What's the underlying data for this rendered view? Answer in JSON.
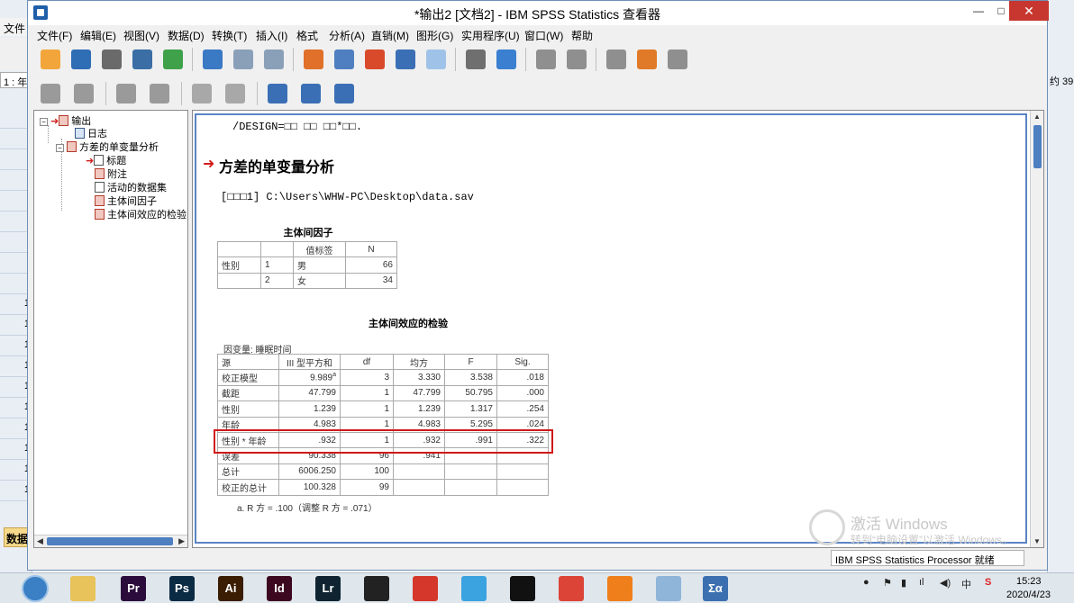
{
  "window": {
    "title": "*输出2 [文档2] - IBM SPSS Statistics 查看器",
    "minimize": "—",
    "maximize": "□",
    "close": "✕"
  },
  "background_editor": {
    "menu": "文件",
    "cell_ref": "1 : 年",
    "right_label": "约 39",
    "rows": [
      "",
      "",
      "",
      "",
      "",
      "",
      "",
      "",
      "",
      "1",
      "1",
      "1",
      "1",
      "1",
      "1",
      "1",
      "1",
      "1",
      "1"
    ],
    "tab": "数据"
  },
  "menubar": {
    "items": [
      "文件(F)",
      "编辑(E)",
      "视图(V)",
      "数据(D)",
      "转换(T)",
      "插入(I)",
      "格式",
      "分析(A)",
      "直销(M)",
      "图形(G)",
      "实用程序(U)",
      "窗口(W)",
      "帮助"
    ]
  },
  "toolbar1": {
    "buttons": [
      "open-icon",
      "save-icon",
      "print-icon",
      "print-preview-icon",
      "export-icon",
      "recall-dialog-icon",
      "undo-icon",
      "redo-icon",
      "goto-data-icon",
      "goto-case-icon",
      "goto-variable-icon",
      "variables-icon",
      "insert-case-icon",
      "insert-variable-icon",
      "split-file-icon",
      "select-cases-icon",
      "weight-cases-icon",
      "value-labels-icon",
      "use-sets-icon",
      "show-all-icon"
    ],
    "colors": [
      "#f2a53a",
      "#2f6db5",
      "#6a6a6a",
      "#3a6ea5",
      "#3fa14a",
      "#3a79c4",
      "#8aa0b8",
      "#8aa0b8",
      "#e0702a",
      "#4f7fc0",
      "#d84a2a",
      "#3a6fb5",
      "#9fc3e8",
      "#6f6f6f",
      "#3a7fd0",
      "#8f8f8f",
      "#8f8f8f",
      "#8f8f8f",
      "#e07a28",
      "#8f8f8f"
    ]
  },
  "toolbar2": {
    "buttons": [
      "promote-icon",
      "demote-icon",
      "expand-icon",
      "collapse-icon",
      "show-icon",
      "hide-icon",
      "insert-heading-icon",
      "insert-title-icon",
      "insert-text-icon"
    ],
    "colors": [
      "#9a9a9a",
      "#9a9a9a",
      "#9a9a9a",
      "#9a9a9a",
      "#a8a8a8",
      "#a8a8a8",
      "#3a6fb5",
      "#3a6fb5",
      "#3a6fb5"
    ]
  },
  "outline": {
    "root": "输出",
    "log": "日志",
    "procedure": "方差的单变量分析",
    "children": [
      "标题",
      "附注",
      "活动的数据集",
      "主体间因子",
      "主体间效应的检验"
    ]
  },
  "content": {
    "design_line": "/DESIGN=□□ □□ □□*□□.",
    "section_title": "方差的单变量分析",
    "dataset_line": "[□□□1] C:\\Users\\WHW-PC\\Desktop\\data.sav",
    "factors_table": {
      "title": "主体间因子",
      "headers": [
        "",
        "",
        "值标签",
        "N"
      ],
      "rows": [
        [
          "性别",
          "1",
          "男",
          "66"
        ],
        [
          "",
          "2",
          "女",
          "34"
        ]
      ]
    },
    "effects_table": {
      "title": "主体间效应的检验",
      "dependent_variable": "因变量: 睡眠时间",
      "headers": [
        "源",
        "III 型平方和",
        "df",
        "均方",
        "F",
        "Sig."
      ],
      "rows": [
        [
          "校正模型",
          "9.989",
          "3",
          "3.330",
          "3.538",
          ".018"
        ],
        [
          "截距",
          "47.799",
          "1",
          "47.799",
          "50.795",
          ".000"
        ],
        [
          "性别",
          "1.239",
          "1",
          "1.239",
          "1.317",
          ".254"
        ],
        [
          "年龄",
          "4.983",
          "1",
          "4.983",
          "5.295",
          ".024"
        ],
        [
          "性别 * 年龄",
          ".932",
          "1",
          ".932",
          ".991",
          ".322"
        ],
        [
          "误差",
          "90.338",
          "96",
          ".941",
          "",
          ""
        ],
        [
          "总计",
          "6006.250",
          "100",
          "",
          "",
          ""
        ],
        [
          "校正的总计",
          "100.328",
          "99",
          "",
          "",
          ""
        ]
      ],
      "superscript": "a",
      "footnote": "a. R 方 = .100（调整 R 方 = .071）"
    },
    "watermark_line1": "激活 Windows",
    "watermark_line2": "转到“电脑设置”以激活 Windows。"
  },
  "status": {
    "text": "IBM SPSS Statistics Processor 就绪"
  },
  "taskbar": {
    "apps": [
      {
        "label": "",
        "name": "file-explorer-icon",
        "color": "#e8c25a"
      },
      {
        "label": "Pr",
        "name": "premiere-icon",
        "color": "#2a0b3c"
      },
      {
        "label": "Ps",
        "name": "photoshop-icon",
        "color": "#0b2a44"
      },
      {
        "label": "Ai",
        "name": "illustrator-icon",
        "color": "#3a1d02"
      },
      {
        "label": "Id",
        "name": "indesign-icon",
        "color": "#3c0820"
      },
      {
        "label": "Lr",
        "name": "lightroom-icon",
        "color": "#0f2430"
      },
      {
        "label": "",
        "name": "video-editor-icon",
        "color": "#222222"
      },
      {
        "label": "",
        "name": "wps-icon",
        "color": "#d5372b"
      },
      {
        "label": "",
        "name": "cloud-icon",
        "color": "#3aa3e0"
      },
      {
        "label": "",
        "name": "qq-icon",
        "color": "#111111"
      },
      {
        "label": "",
        "name": "chrome-icon",
        "color": "#db4437"
      },
      {
        "label": "",
        "name": "browser-icon",
        "color": "#ef7f1a"
      },
      {
        "label": "",
        "name": "notes-icon",
        "color": "#8fb5d8"
      },
      {
        "label": "Σα",
        "name": "spss-icon",
        "color": "#3b6fb0"
      }
    ],
    "tray_ime": "中",
    "tray_s": "S",
    "time": "15:23",
    "date": "2020/4/23"
  }
}
